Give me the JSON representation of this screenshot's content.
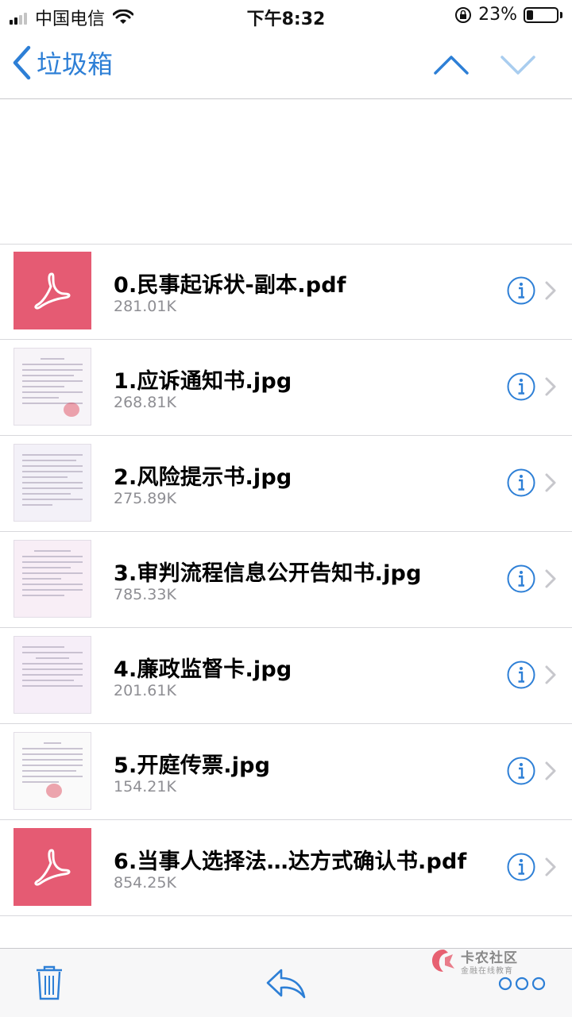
{
  "status_bar": {
    "carrier": "中国电信",
    "time": "下午8:32",
    "battery_percent": "23%",
    "battery_level": 0.23,
    "signal_bars": 2
  },
  "nav": {
    "back_label": "垃圾箱",
    "back_icon": "chevron-left-icon",
    "prev_icon": "chevron-up-icon",
    "next_icon": "chevron-down-icon",
    "accent_color": "#2d7fd6"
  },
  "attachments": [
    {
      "name": "0.民事起诉状-副本.pdf",
      "size": "281.01K",
      "type": "pdf"
    },
    {
      "name": "1.应诉通知书.jpg",
      "size": "268.81K",
      "type": "image"
    },
    {
      "name": "2.风险提示书.jpg",
      "size": "275.89K",
      "type": "image"
    },
    {
      "name": "3.审判流程信息公开告知书.jpg",
      "size": "785.33K",
      "type": "image"
    },
    {
      "name": "4.廉政监督卡.jpg",
      "size": "201.61K",
      "type": "image"
    },
    {
      "name": "5.开庭传票.jpg",
      "size": "154.21K",
      "type": "image"
    },
    {
      "name": "6.当事人选择法…达方式确认书.pdf",
      "size": "854.25K",
      "type": "pdf"
    }
  ],
  "toolbar": {
    "trash_icon": "trash-icon",
    "reply_icon": "reply-icon",
    "more_icon": "more-icon"
  },
  "watermark": {
    "title": "卡农社区",
    "subtitle": "金融在线教育"
  },
  "colors": {
    "pdf_thumb": "#e55b73",
    "secondary_text": "#8e8e93"
  }
}
